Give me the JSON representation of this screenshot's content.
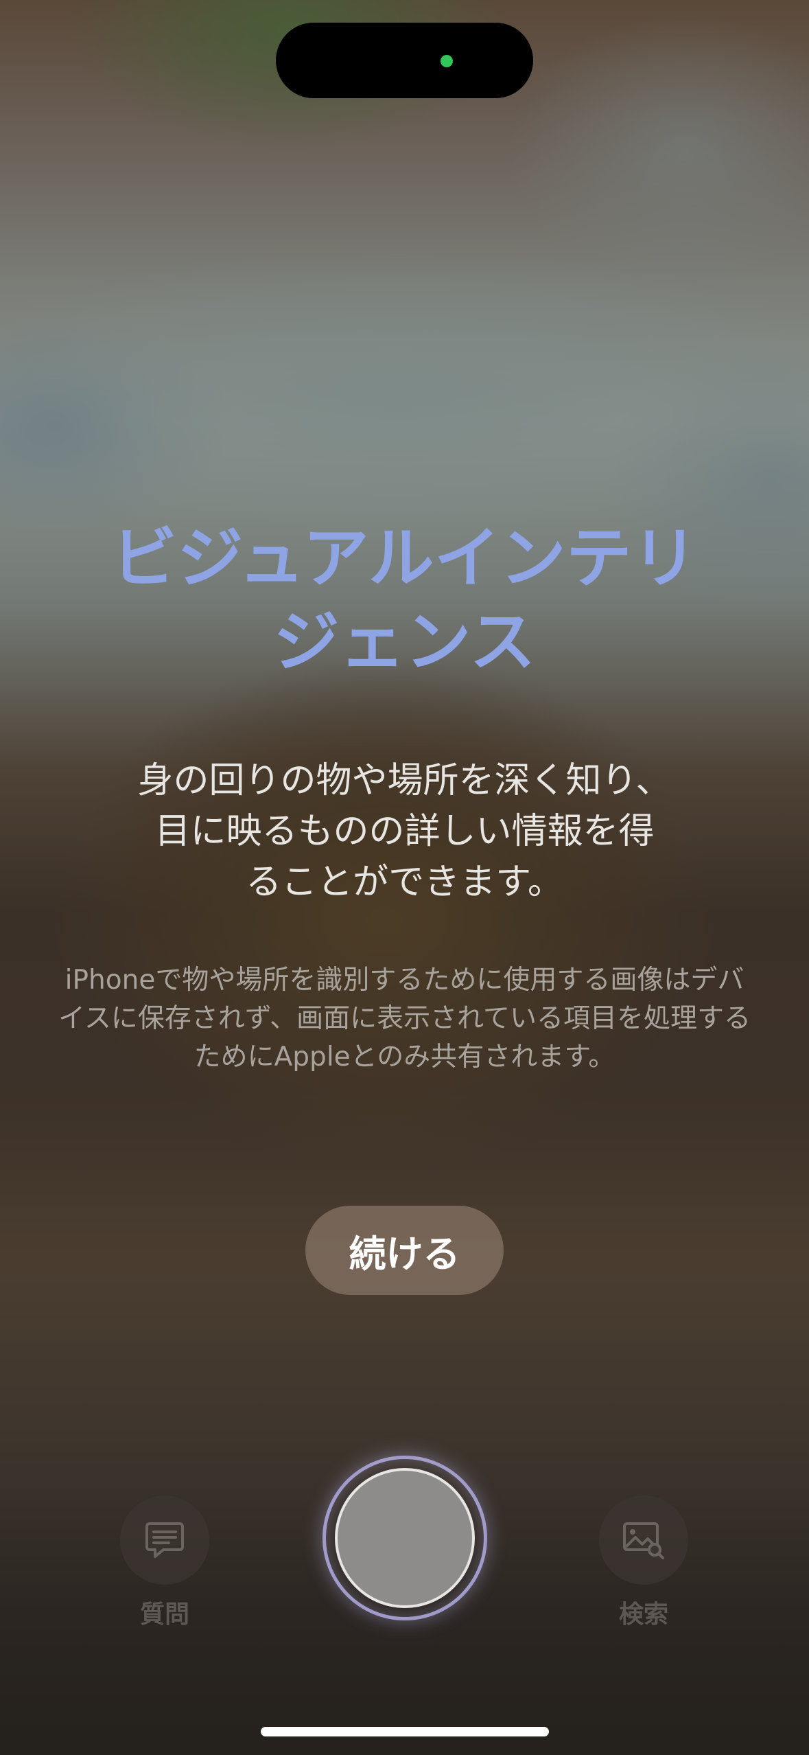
{
  "intro": {
    "title": "ビジュアルインテリジェンス",
    "subtitle": "身の回りの物や場所を深く知り、目に映るものの詳しい情報を得ることができます。",
    "notice": "iPhoneで物や場所を識別するために使用する画像はデバイスに保存されず、画面に表示されている項目を処理するためにAppleとのみ共有されます。",
    "continue_label": "続ける"
  },
  "controls": {
    "ask_label": "質問",
    "search_label": "検索",
    "ask_icon": "chat-bubble-icon",
    "search_icon": "image-search-icon"
  },
  "colors": {
    "title": "#8ea4e4",
    "status_dot": "#33c759"
  }
}
